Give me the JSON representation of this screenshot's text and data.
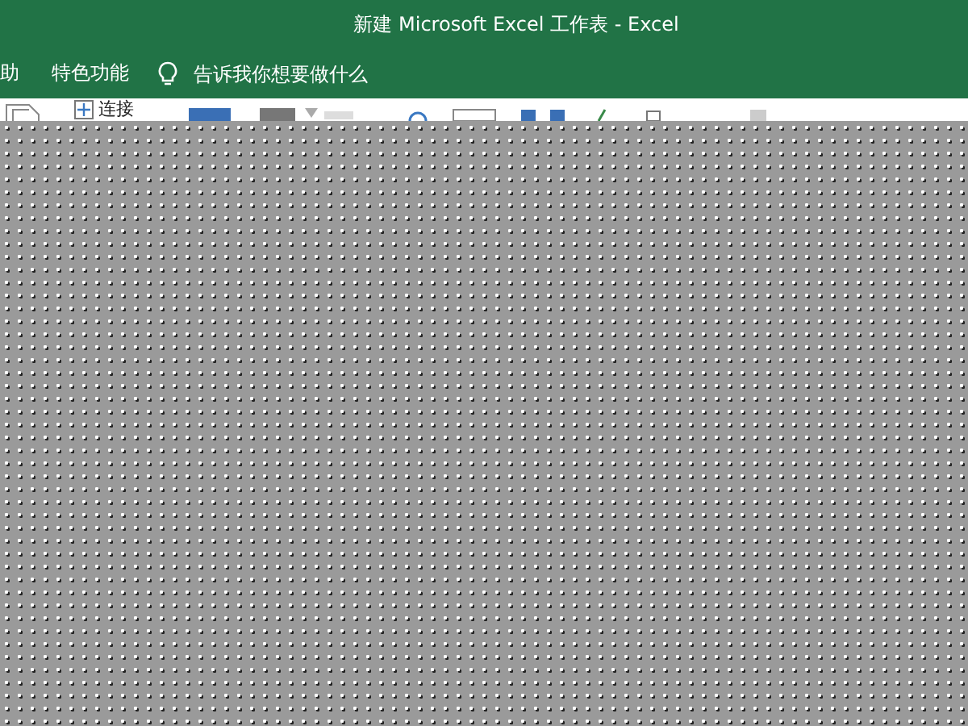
{
  "window": {
    "title": "新建 Microsoft Excel 工作表  -  Excel"
  },
  "tabs": [
    {
      "label": "助"
    },
    {
      "label": "特色功能"
    }
  ],
  "tell_me": {
    "placeholder": "告诉我你想要做什么"
  },
  "ribbon": {
    "items": [
      {
        "label": "连接"
      }
    ]
  }
}
